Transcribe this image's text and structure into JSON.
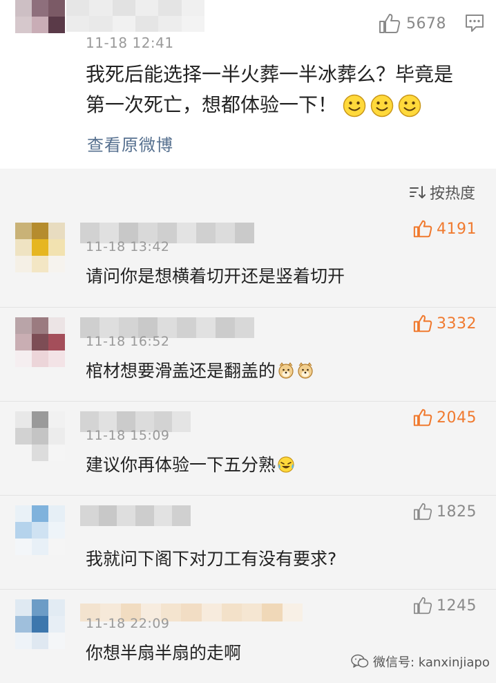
{
  "post": {
    "likes": "5678",
    "time": "11-18 12:41",
    "text_line1": "我死后能选择一半火葬一半冰葬么？毕竟是",
    "text_line2": "第一次死亡，想都体验一下！",
    "view_original": "查看原微博"
  },
  "sort_label": "按热度",
  "comments": [
    {
      "time": "11-18 13:42",
      "text": "请问你是想横着切开还是竖着切开",
      "likes": "4191",
      "liked": true
    },
    {
      "time": "11-18 16:52",
      "text": "棺材想要滑盖还是翻盖的",
      "likes": "3332",
      "liked": true
    },
    {
      "time": "11-18 15:09",
      "text": "建议你再体验一下五分熟",
      "likes": "2045",
      "liked": true
    },
    {
      "time": "",
      "text": "我就问下阁下对刀工有没有要求?",
      "likes": "1825",
      "liked": false
    },
    {
      "time": "11-18 22:09",
      "text": "你想半扇半扇的走啊",
      "likes": "1245",
      "liked": false
    }
  ],
  "watermark": "微信号: kanxinjiapo",
  "colors": {
    "liked": "#f07a2f",
    "unliked": "#8a8a8a",
    "link": "#56708f"
  }
}
